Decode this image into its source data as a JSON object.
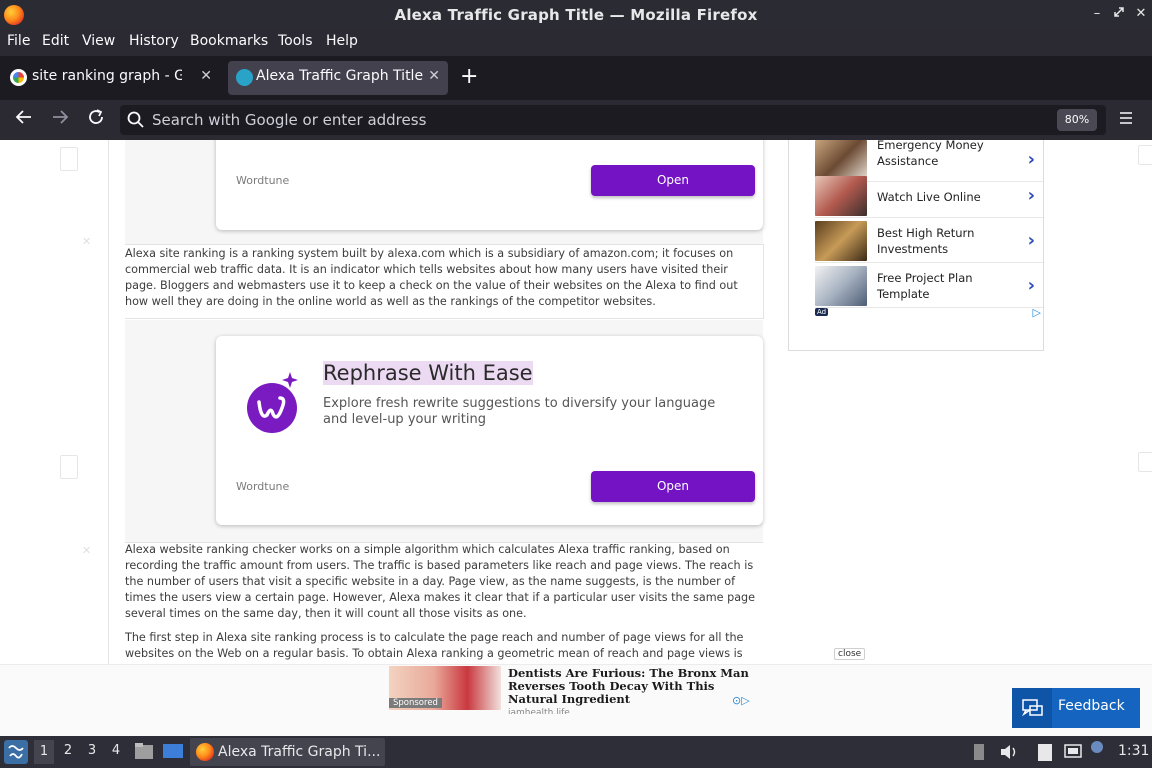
{
  "window": {
    "title": "Alexa Traffic Graph Title — Mozilla Firefox",
    "controls": [
      "–",
      "✕",
      "✕"
    ]
  },
  "menubar": {
    "items": [
      "File",
      "Edit",
      "View",
      "History",
      "Bookmarks",
      "Tools",
      "Help"
    ]
  },
  "tabs": [
    {
      "label": "site ranking graph - Google Search",
      "active": false
    },
    {
      "label": "Alexa Traffic Graph Title",
      "active": true
    }
  ],
  "navbar": {
    "search_placeholder": "Search with Google or enter address",
    "zoom": "80%"
  },
  "page": {
    "card_top": {
      "brand": "Wordtune",
      "button": "Open"
    },
    "paragraph1": "Alexa site ranking is a ranking system built by alexa.com which is a subsidiary of amazon.com; it focuses on commercial web traffic data. It is an indicator which tells websites about how many users have visited their page. Bloggers and webmasters use it to keep a check on the value of their websites on the Alexa to find out how well they are doing in the online world as well as the rankings of the competitor websites.",
    "card_main": {
      "headline": "Rephrase With Ease",
      "description": "Explore fresh rewrite suggestions to diversify your language and level-up your writing",
      "brand": "Wordtune",
      "button": "Open"
    },
    "paragraph2": "Alexa website ranking checker works on a simple algorithm which calculates Alexa traffic ranking, based on recording the traffic amount from users. The traffic is based parameters like reach and page views. The reach is the number of users that visit a specific website in a day. Page view, as the name suggests, is the number of times the users view a certain page. However, Alexa makes it clear that if a particular user visits the same page several times on the same day, then it will count all those visits as one.",
    "paragraph3": "The first step in Alexa site ranking process is to calculate the page reach and number of page views for all the websites on the Web on a regular basis. To obtain Alexa ranking a geometric mean of reach and page views is"
  },
  "side_ads": {
    "items": [
      {
        "text": "Emergency Money Assistance"
      },
      {
        "text": "Watch Live Online"
      },
      {
        "text": "Best High Return Investments"
      },
      {
        "text": "Free Project Plan Template"
      }
    ],
    "ad_label": "Ad"
  },
  "banner_ad": {
    "sponsored": "Sponsored",
    "headline": "Dentists Are Furious: The Bronx Man Reverses Tooth Decay With This Natural Ingredient",
    "source": "iamhealth.life",
    "close": "close"
  },
  "feedback": {
    "label": "Feedback"
  },
  "taskbar": {
    "workspaces": [
      "1",
      "2",
      "3",
      "4"
    ],
    "task_label": "Alexa Traffic Graph Ti...",
    "clock": "1:31"
  }
}
